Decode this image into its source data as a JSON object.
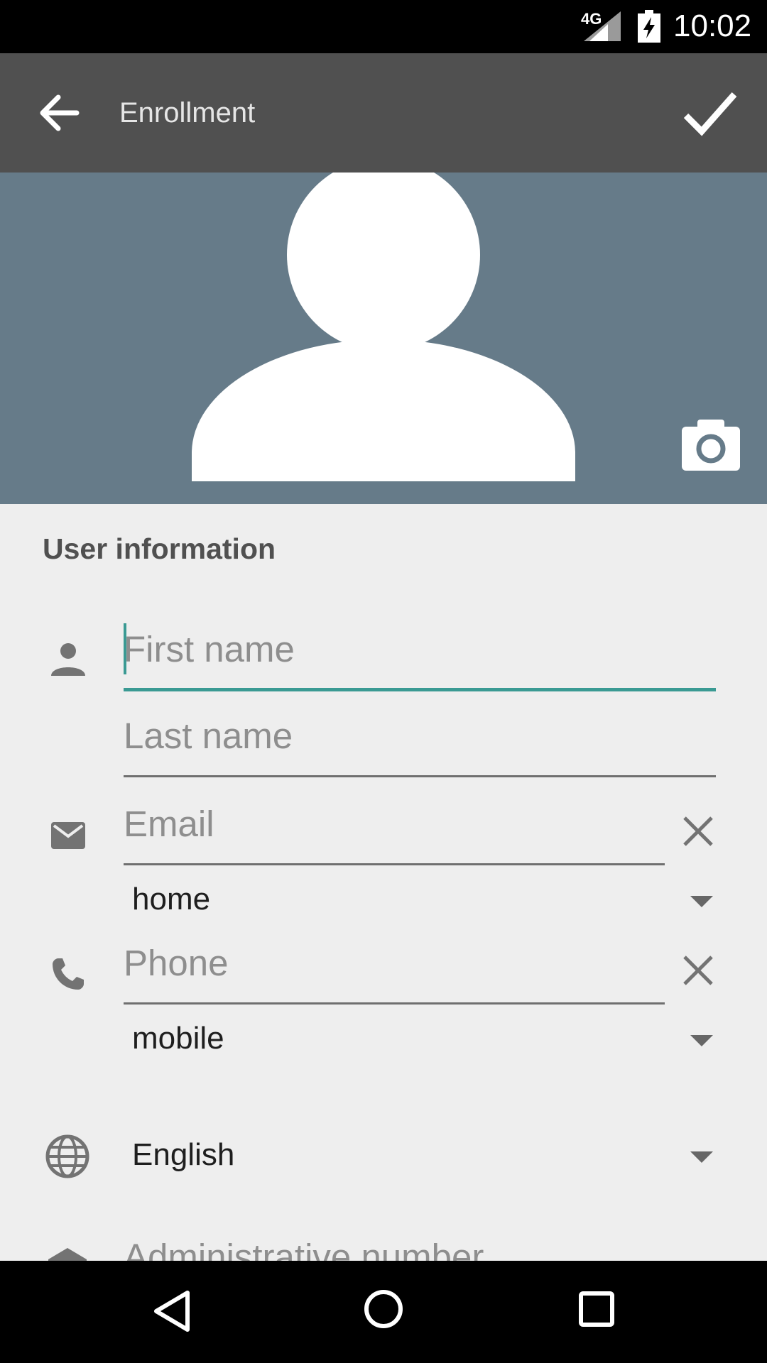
{
  "status_bar": {
    "network": "4G",
    "time": "10:02"
  },
  "app_bar": {
    "title": "Enrollment"
  },
  "section": {
    "title": "User information"
  },
  "form": {
    "first_name_placeholder": "First name",
    "last_name_placeholder": "Last name",
    "email_placeholder": "Email",
    "email_type": "home",
    "phone_placeholder": "Phone",
    "phone_type": "mobile",
    "language": "English",
    "admin_number_placeholder": "Administrative number"
  },
  "colors": {
    "accent": "#3a9a93",
    "app_bar": "#505050",
    "hero": "#667b89"
  }
}
